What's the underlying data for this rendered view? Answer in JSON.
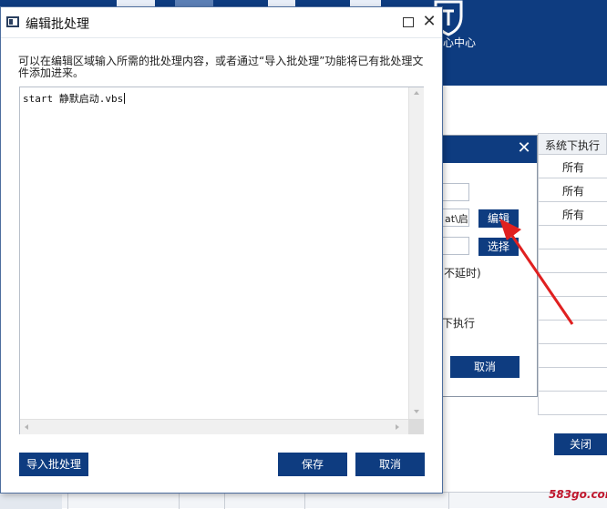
{
  "background_app": {
    "center_label": "心中心",
    "table": {
      "header": "系统下执行",
      "rows": [
        "所有",
        "所有",
        "所有"
      ]
    },
    "close_label": "关闭",
    "watermark": "583go.com"
  },
  "middle_dialog": {
    "close_glyph": "✕",
    "path_fragment": "at\\启",
    "edit_label": "编辑",
    "select_label": "选择",
    "text_no_delay": "不延时)",
    "text_exec": "下执行",
    "cancel_label": "取消"
  },
  "edit_dialog": {
    "title": "编辑批处理",
    "close_glyph": "✕",
    "description": "可以在编辑区域输入所需的批处理内容，或者通过“导入批处理”功能将已有批处理文件添加进来。",
    "content": "start 静默启动.vbs",
    "import_label": "导入批处理",
    "save_label": "保存",
    "cancel_label": "取消"
  },
  "colors": {
    "navy": "#0e3c80",
    "arrow_red": "#e02020"
  }
}
